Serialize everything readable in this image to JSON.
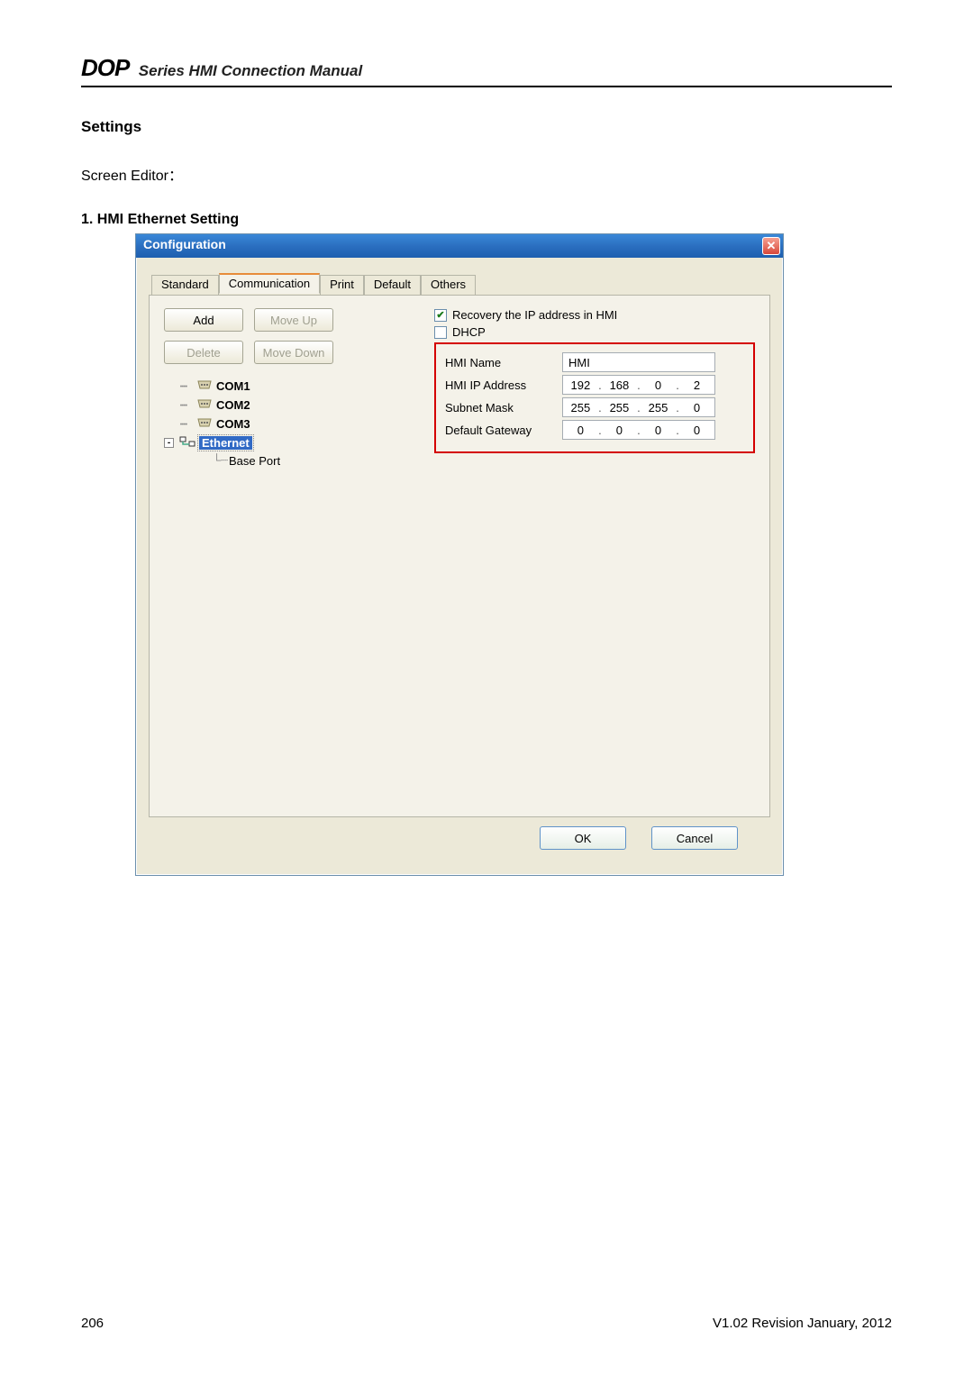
{
  "doc": {
    "brand": "DOP",
    "header_rest": "Series HMI Connection Manual",
    "settings_heading": "Settings",
    "screen_editor": "Screen Editor：",
    "list_item": "1.  HMI Ethernet Setting",
    "page_number": "206",
    "footer_version": "V1.02   Revision January, 2012"
  },
  "dialog": {
    "title": "Configuration",
    "close": "✕",
    "tabs": {
      "standard": "Standard",
      "communication": "Communication",
      "print": "Print",
      "default": "Default",
      "others": "Others"
    },
    "buttons": {
      "add": "Add",
      "move_up": "Move Up",
      "delete": "Delete",
      "move_down": "Move Down",
      "ok": "OK",
      "cancel": "Cancel"
    },
    "tree": {
      "com1": "COM1",
      "com2": "COM2",
      "com3": "COM3",
      "ethernet": "Ethernet",
      "base_port": "Base Port"
    },
    "right": {
      "recovery_label": "Recovery the IP address in HMI",
      "recovery_checked": "✔",
      "dhcp_label": "DHCP",
      "hmi_name_label": "HMI Name",
      "hmi_name_value": "HMI",
      "hmi_ip_label": "HMI IP Address",
      "hmi_ip": {
        "a": "192",
        "b": "168",
        "c": "0",
        "d": "2"
      },
      "subnet_label": "Subnet Mask",
      "subnet": {
        "a": "255",
        "b": "255",
        "c": "255",
        "d": "0"
      },
      "gateway_label": "Default Gateway",
      "gateway": {
        "a": "0",
        "b": "0",
        "c": "0",
        "d": "0"
      }
    }
  }
}
